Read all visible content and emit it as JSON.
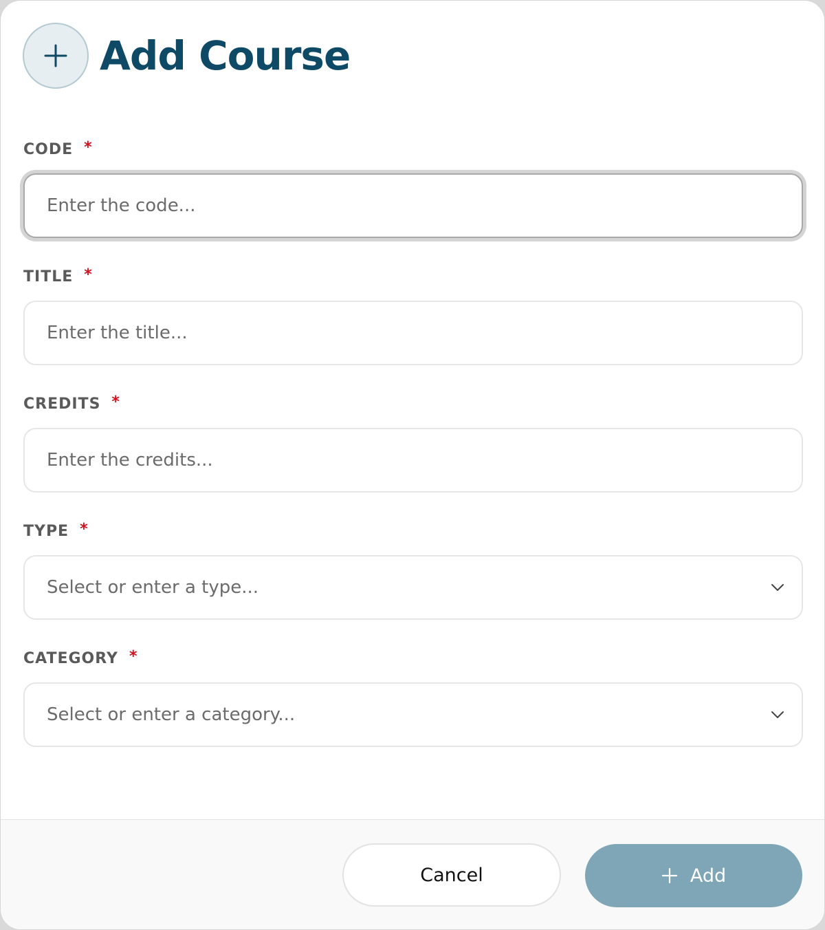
{
  "dialog": {
    "title": "Add Course"
  },
  "fields": {
    "code": {
      "label": "CODE",
      "required_mark": "*",
      "placeholder": "Enter the code...",
      "value": ""
    },
    "title": {
      "label": "TITLE",
      "required_mark": "*",
      "placeholder": "Enter the title...",
      "value": ""
    },
    "credits": {
      "label": "CREDITS",
      "required_mark": "*",
      "placeholder": "Enter the credits...",
      "value": ""
    },
    "type": {
      "label": "TYPE",
      "required_mark": "*",
      "placeholder": "Select or enter a type..."
    },
    "category": {
      "label": "CATEGORY",
      "required_mark": "*",
      "placeholder": "Select or enter a category..."
    }
  },
  "footer": {
    "cancel_label": "Cancel",
    "add_label": "Add"
  },
  "icons": {
    "header": "plus-icon",
    "select": "chevron-down-icon",
    "add_button": "plus-icon"
  },
  "colors": {
    "title": "#0e4a66",
    "required": "#d0101e",
    "add_button_bg": "#7fa6b7"
  }
}
